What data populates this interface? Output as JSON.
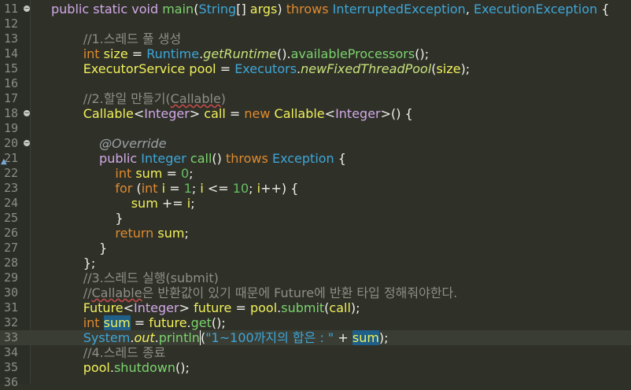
{
  "editor": {
    "lines": [
      {
        "num": "11",
        "fold": true,
        "parts": [
          [
            "kw",
            "public"
          ],
          [
            "plain",
            " "
          ],
          [
            "kw",
            "static"
          ],
          [
            "plain",
            " "
          ],
          [
            "kw",
            "void"
          ],
          [
            "plain",
            " "
          ],
          [
            "meth-green",
            "main"
          ],
          [
            "plain",
            "("
          ],
          [
            "type",
            "String"
          ],
          [
            "plain",
            "[] "
          ],
          [
            "ident",
            "args"
          ],
          [
            "plain",
            ") "
          ],
          [
            "kw2",
            "throws"
          ],
          [
            "plain",
            " "
          ],
          [
            "type",
            "InterruptedException"
          ],
          [
            "plain",
            ", "
          ],
          [
            "type",
            "ExecutionException"
          ],
          [
            "plain",
            " {"
          ]
        ]
      },
      {
        "num": "12",
        "parts": []
      },
      {
        "num": "13",
        "parts": [
          [
            "comment",
            "        //1.스레드 풀 생성"
          ]
        ]
      },
      {
        "num": "14",
        "parts": [
          [
            "plain",
            "        "
          ],
          [
            "kw2",
            "int"
          ],
          [
            "plain",
            " "
          ],
          [
            "ident",
            "size"
          ],
          [
            "plain",
            " = "
          ],
          [
            "type",
            "Runtime"
          ],
          [
            "plain",
            "."
          ],
          [
            "static-call",
            "getRuntime"
          ],
          [
            "plain",
            "()."
          ],
          [
            "meth-green",
            "availableProcessors"
          ],
          [
            "plain",
            "();"
          ]
        ]
      },
      {
        "num": "15",
        "parts": [
          [
            "plain",
            "        "
          ],
          [
            "ident",
            "ExecutorService"
          ],
          [
            "plain",
            " "
          ],
          [
            "ident",
            "pool"
          ],
          [
            "plain",
            " = "
          ],
          [
            "type",
            "Executors"
          ],
          [
            "plain",
            "."
          ],
          [
            "static-call",
            "newFixedThreadPool"
          ],
          [
            "plain",
            "("
          ],
          [
            "ident",
            "size"
          ],
          [
            "plain",
            ");"
          ]
        ]
      },
      {
        "num": "16",
        "parts": []
      },
      {
        "num": "17",
        "parts": [
          [
            "comment",
            "        //2.할일 만들기("
          ],
          [
            "comment squig",
            "Callable"
          ],
          [
            "comment",
            ")"
          ]
        ]
      },
      {
        "num": "18",
        "fold": true,
        "parts": [
          [
            "plain",
            "        "
          ],
          [
            "ident",
            "Callable"
          ],
          [
            "plain",
            "<"
          ],
          [
            "kw",
            "Integer"
          ],
          [
            "plain",
            "> "
          ],
          [
            "ident",
            "call"
          ],
          [
            "plain",
            " = "
          ],
          [
            "kw2",
            "new"
          ],
          [
            "plain",
            " "
          ],
          [
            "ident",
            "Callable"
          ],
          [
            "plain",
            "<"
          ],
          [
            "kw",
            "Integer"
          ],
          [
            "plain",
            ">() {"
          ]
        ]
      },
      {
        "num": "19",
        "parts": []
      },
      {
        "num": "20",
        "fold": true,
        "parts": [
          [
            "anno",
            "            @Override"
          ]
        ]
      },
      {
        "num": "21",
        "marker": true,
        "parts": [
          [
            "plain",
            "            "
          ],
          [
            "kw",
            "public"
          ],
          [
            "plain",
            " "
          ],
          [
            "type",
            "Integer"
          ],
          [
            "plain",
            " "
          ],
          [
            "meth-green",
            "call"
          ],
          [
            "plain",
            "() "
          ],
          [
            "kw2",
            "throws"
          ],
          [
            "plain",
            " "
          ],
          [
            "type",
            "Exception"
          ],
          [
            "plain",
            " {"
          ]
        ]
      },
      {
        "num": "22",
        "parts": [
          [
            "plain",
            "                "
          ],
          [
            "kw2",
            "int"
          ],
          [
            "plain",
            " "
          ],
          [
            "ident",
            "sum"
          ],
          [
            "plain",
            " = "
          ],
          [
            "num",
            "0"
          ],
          [
            "plain",
            ";"
          ]
        ]
      },
      {
        "num": "23",
        "parts": [
          [
            "plain",
            "                "
          ],
          [
            "kw2",
            "for"
          ],
          [
            "plain",
            " ("
          ],
          [
            "kw2",
            "int"
          ],
          [
            "plain",
            " "
          ],
          [
            "ident",
            "i"
          ],
          [
            "plain",
            " = "
          ],
          [
            "num",
            "1"
          ],
          [
            "plain",
            "; "
          ],
          [
            "ident",
            "i"
          ],
          [
            "plain",
            " <= "
          ],
          [
            "num",
            "10"
          ],
          [
            "plain",
            "; "
          ],
          [
            "ident",
            "i"
          ],
          [
            "plain",
            "++) {"
          ]
        ]
      },
      {
        "num": "24",
        "parts": [
          [
            "plain",
            "                    "
          ],
          [
            "ident",
            "sum"
          ],
          [
            "plain",
            " += "
          ],
          [
            "ident",
            "i"
          ],
          [
            "plain",
            ";"
          ]
        ]
      },
      {
        "num": "25",
        "parts": [
          [
            "plain",
            "                }"
          ]
        ]
      },
      {
        "num": "26",
        "parts": [
          [
            "plain",
            "                "
          ],
          [
            "kw2",
            "return"
          ],
          [
            "plain",
            " "
          ],
          [
            "ident",
            "sum"
          ],
          [
            "plain",
            ";"
          ]
        ]
      },
      {
        "num": "27",
        "parts": [
          [
            "plain",
            "            }"
          ]
        ]
      },
      {
        "num": "28",
        "parts": [
          [
            "plain",
            "        };"
          ]
        ]
      },
      {
        "num": "29",
        "parts": [
          [
            "comment",
            "        //3.스레드 실행(submit)"
          ]
        ]
      },
      {
        "num": "30",
        "parts": [
          [
            "comment",
            "        //"
          ],
          [
            "comment squig",
            "Callable"
          ],
          [
            "comment",
            "은 반환값이 있기 때문에 Future에 반환 타입 정해줘야한다."
          ]
        ]
      },
      {
        "num": "31",
        "parts": [
          [
            "plain",
            "        "
          ],
          [
            "ident",
            "Future"
          ],
          [
            "plain",
            "<"
          ],
          [
            "kw",
            "Integer"
          ],
          [
            "plain",
            "> "
          ],
          [
            "ident",
            "future"
          ],
          [
            "plain",
            " = "
          ],
          [
            "ident",
            "pool"
          ],
          [
            "plain",
            "."
          ],
          [
            "meth-green",
            "submit"
          ],
          [
            "plain",
            "("
          ],
          [
            "ident",
            "call"
          ],
          [
            "plain",
            ");"
          ]
        ]
      },
      {
        "num": "32",
        "parts": [
          [
            "plain",
            "        "
          ],
          [
            "kw2",
            "int"
          ],
          [
            "plain",
            " "
          ],
          [
            "hl",
            "sum"
          ],
          [
            "plain",
            " = "
          ],
          [
            "ident",
            "future"
          ],
          [
            "plain",
            "."
          ],
          [
            "meth-green",
            "get"
          ],
          [
            "plain",
            "();"
          ]
        ]
      },
      {
        "num": "33",
        "current": true,
        "parts": [
          [
            "plain",
            "        "
          ],
          [
            "type",
            "System"
          ],
          [
            "plain",
            "."
          ],
          [
            "ident italic",
            "out"
          ],
          [
            "plain",
            "."
          ],
          [
            "meth-green caret",
            "println"
          ],
          [
            "plain",
            "("
          ],
          [
            "str",
            "\"1~100까지의 합은 : \""
          ],
          [
            "plain",
            " + "
          ],
          [
            "hl",
            "sum"
          ],
          [
            "plain",
            ");"
          ]
        ]
      },
      {
        "num": "34",
        "parts": [
          [
            "comment",
            "        //4.스레드 종료"
          ]
        ]
      },
      {
        "num": "35",
        "parts": [
          [
            "plain",
            "        "
          ],
          [
            "ident",
            "pool"
          ],
          [
            "plain",
            "."
          ],
          [
            "meth-green",
            "shutdown"
          ],
          [
            "plain",
            "();"
          ]
        ]
      },
      {
        "num": "36",
        "parts": []
      }
    ]
  }
}
